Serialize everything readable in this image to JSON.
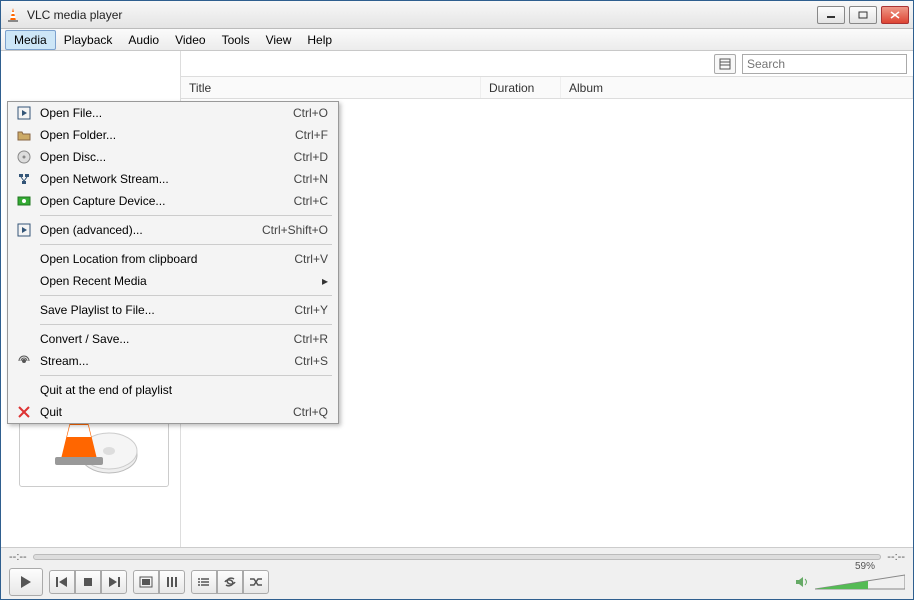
{
  "window": {
    "title": "VLC media player"
  },
  "menubar": [
    "Media",
    "Playback",
    "Audio",
    "Video",
    "Tools",
    "View",
    "Help"
  ],
  "menu_active_index": 0,
  "media_menu": {
    "groups": [
      [
        {
          "icon": "file-play",
          "label": "Open File...",
          "shortcut": "Ctrl+O"
        },
        {
          "icon": "folder",
          "label": "Open Folder...",
          "shortcut": "Ctrl+F"
        },
        {
          "icon": "disc",
          "label": "Open Disc...",
          "shortcut": "Ctrl+D"
        },
        {
          "icon": "network",
          "label": "Open Network Stream...",
          "shortcut": "Ctrl+N"
        },
        {
          "icon": "capture",
          "label": "Open Capture Device...",
          "shortcut": "Ctrl+C"
        }
      ],
      [
        {
          "icon": "file-play",
          "label": "Open (advanced)...",
          "shortcut": "Ctrl+Shift+O"
        }
      ],
      [
        {
          "icon": "",
          "label": "Open Location from clipboard",
          "shortcut": "Ctrl+V"
        },
        {
          "icon": "",
          "label": "Open Recent Media",
          "shortcut": "",
          "submenu": true
        }
      ],
      [
        {
          "icon": "",
          "label": "Save Playlist to File...",
          "shortcut": "Ctrl+Y"
        }
      ],
      [
        {
          "icon": "",
          "label": "Convert / Save...",
          "shortcut": "Ctrl+R"
        },
        {
          "icon": "stream",
          "label": "Stream...",
          "shortcut": "Ctrl+S"
        }
      ],
      [
        {
          "icon": "",
          "label": "Quit at the end of playlist",
          "shortcut": ""
        },
        {
          "icon": "quit",
          "label": "Quit",
          "shortcut": "Ctrl+Q"
        }
      ]
    ]
  },
  "search": {
    "placeholder": "Search"
  },
  "columns": {
    "title": "Title",
    "duration": "Duration",
    "album": "Album"
  },
  "seek": {
    "elapsed": "--:--",
    "total": "--:--"
  },
  "volume": {
    "percent_label": "59%",
    "percent_value": 59
  }
}
